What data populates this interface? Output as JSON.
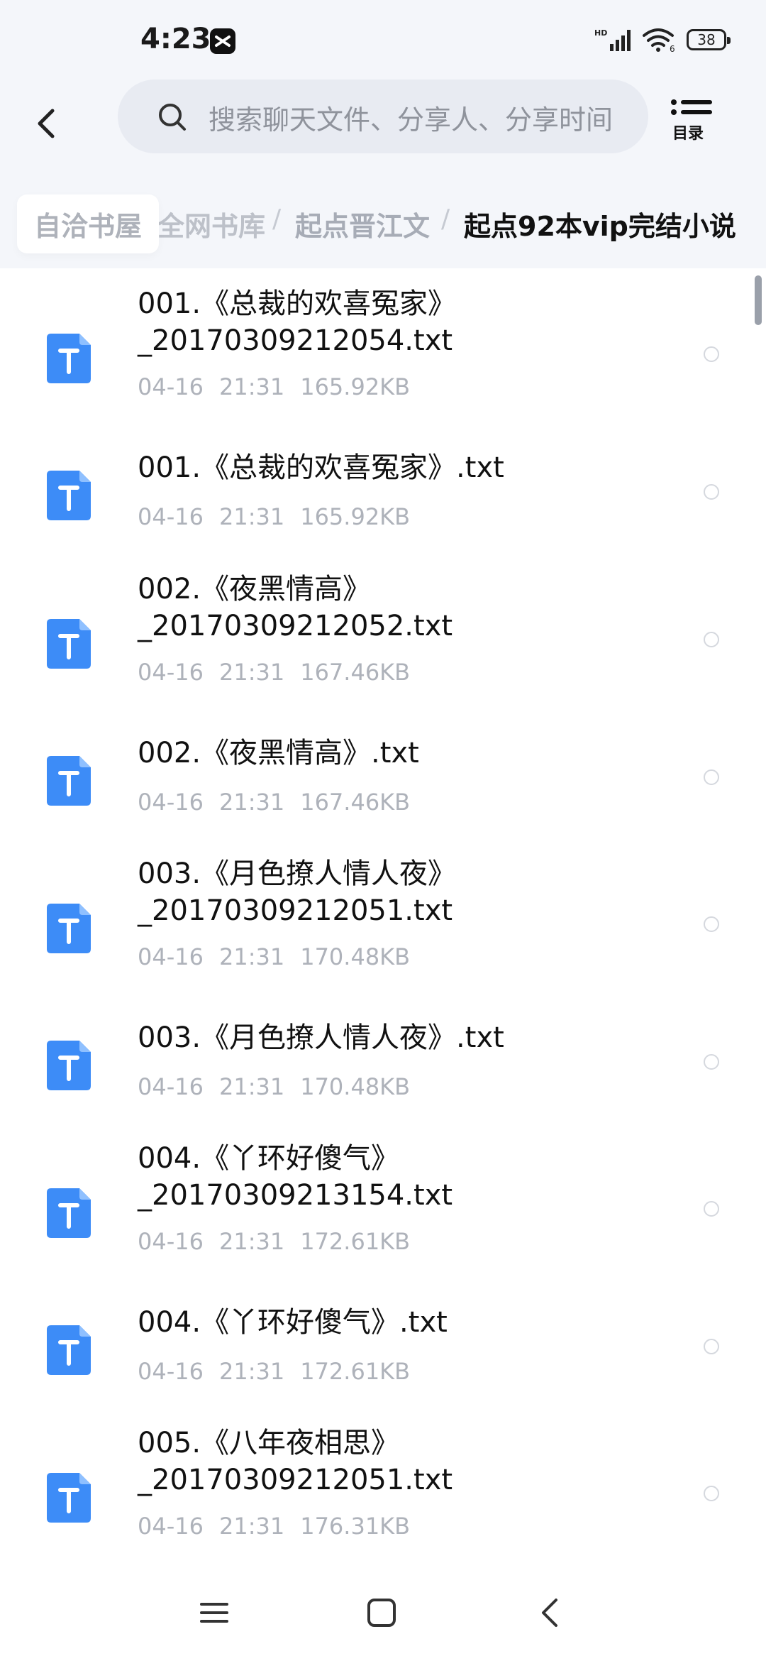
{
  "status_bar": {
    "time": "4:23",
    "battery": "38",
    "network": "HD",
    "wifi_label": "6"
  },
  "header": {
    "search_placeholder": "搜索聊天文件、分享人、分享时间",
    "catalog_label": "目录"
  },
  "breadcrumb": [
    "自洽书屋",
    "全网书库",
    "起点晋江文",
    "起点92本vip完结小说"
  ],
  "breadcrumb_separator": "/",
  "files": [
    {
      "name_line1": "001.《总裁的欢喜冤家》",
      "name_line2": "_20170309212054.txt",
      "date": "04-16",
      "time": "21:31",
      "size": "165.92KB"
    },
    {
      "name_line1": "001.《总裁的欢喜冤家》.txt",
      "name_line2": "",
      "date": "04-16",
      "time": "21:31",
      "size": "165.92KB"
    },
    {
      "name_line1": "002.《夜黑情高》",
      "name_line2": "_20170309212052.txt",
      "date": "04-16",
      "time": "21:31",
      "size": "167.46KB"
    },
    {
      "name_line1": "002.《夜黑情高》.txt",
      "name_line2": "",
      "date": "04-16",
      "time": "21:31",
      "size": "167.46KB"
    },
    {
      "name_line1": "003.《月色撩人情人夜》",
      "name_line2": "_20170309212051.txt",
      "date": "04-16",
      "time": "21:31",
      "size": "170.48KB"
    },
    {
      "name_line1": "003.《月色撩人情人夜》.txt",
      "name_line2": "",
      "date": "04-16",
      "time": "21:31",
      "size": "170.48KB"
    },
    {
      "name_line1": "004.《丫环好傻气》",
      "name_line2": "_20170309213154.txt",
      "date": "04-16",
      "time": "21:31",
      "size": "172.61KB"
    },
    {
      "name_line1": "004.《丫环好傻气》.txt",
      "name_line2": "",
      "date": "04-16",
      "time": "21:31",
      "size": "172.61KB"
    },
    {
      "name_line1": "005.《八年夜相思》",
      "name_line2": "_20170309212051.txt",
      "date": "04-16",
      "time": "21:31",
      "size": "176.31KB"
    }
  ],
  "icons": {
    "back": "chevron-left-icon",
    "search": "search-icon",
    "catalog": "list-icon",
    "file": "txt-file-icon",
    "nav_menu": "menu-icon",
    "nav_home": "home-icon",
    "nav_back": "back-icon"
  },
  "colors": {
    "accent": "#3d8cf7",
    "header_bg": "#f4f6fa",
    "muted_text": "#aeb2ba"
  }
}
